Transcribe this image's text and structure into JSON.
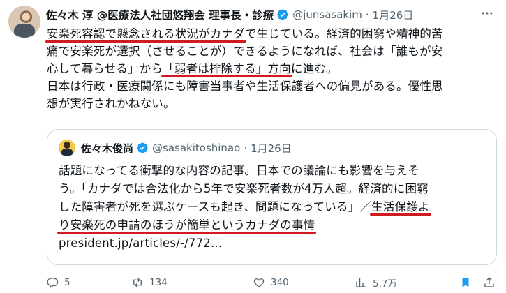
{
  "tweet": {
    "author_name": "佐々木 淳 @医療法人社団悠翔会 理事長・診療",
    "author_handle": "@junsasakim",
    "separator": "·",
    "date": "1月26日",
    "lines": [
      {
        "segments": [
          {
            "text": "安楽死容認で懸念される状況がカナダ",
            "underline": true
          },
          {
            "text": "で生じている。経済的困窮や精神的苦",
            "underline": false
          }
        ]
      },
      {
        "segments": [
          {
            "text": "痛で安楽死が選択（させることが）できるようになれば、社会は「誰もが安",
            "underline": false
          }
        ]
      },
      {
        "segments": [
          {
            "text": "心して暮らせる」から",
            "underline": false
          },
          {
            "text": "「弱者は排除する」方向",
            "underline": true
          },
          {
            "text": "に進む。",
            "underline": false
          }
        ]
      },
      {
        "segments": [
          {
            "text": "日本は行政・医療関係にも障害当事者や生活保護者への偏見がある。優性思",
            "underline": false
          }
        ]
      },
      {
        "segments": [
          {
            "text": "想が実行されかねない。",
            "underline": false
          }
        ]
      }
    ]
  },
  "quote": {
    "author_name": "佐々木俊尚",
    "author_handle": "@sasakitoshinao",
    "separator": "·",
    "date": "1月26日",
    "lines": [
      {
        "segments": [
          {
            "text": "話題になってる衝撃的な内容の記事。日本での議論にも影響を与えそ",
            "underline": false
          }
        ]
      },
      {
        "segments": [
          {
            "text": "う。「カナダでは合法化から5年で安楽死者数が4万人超。経済的に困窮",
            "underline": false
          }
        ]
      },
      {
        "segments": [
          {
            "text": "した障害者が死を選ぶケースも起き、問題になっている」／",
            "underline": false
          },
          {
            "text": "生活保護よ",
            "underline": true
          }
        ]
      },
      {
        "segments": [
          {
            "text": "り安楽死の申請のほうが簡単というカナダの事情",
            "underline": true
          }
        ]
      }
    ],
    "link_text": "president.jp/articles/-/772..."
  },
  "actions": {
    "replies": "5",
    "reposts": "134",
    "likes": "340",
    "views": "5.7万"
  },
  "colors": {
    "verified": "#1d9bf0",
    "underline": "#d21a22",
    "muted": "#536471",
    "border": "#cfd9de"
  },
  "icons": [
    "more-icon",
    "verified-badge-icon",
    "reply-icon",
    "repost-icon",
    "like-icon",
    "views-icon",
    "bookmark-icon",
    "share-icon"
  ]
}
